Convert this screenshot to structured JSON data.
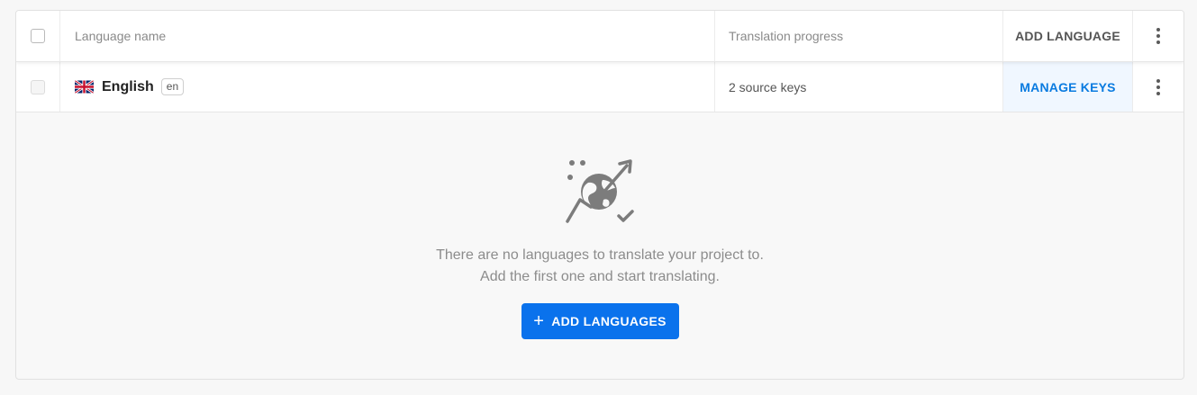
{
  "header": {
    "columns": {
      "language_name": "Language name",
      "translation_progress": "Translation progress"
    },
    "add_language_label": "ADD LANGUAGE",
    "menu_icon": "kebab-menu-icon"
  },
  "languages": [
    {
      "flag_icon": "uk-flag-icon",
      "name": "English",
      "code": "en",
      "progress": "2 source keys",
      "action_label": "MANAGE KEYS"
    }
  ],
  "empty_state": {
    "icon": "globe-translate-icon",
    "line1": "There are no languages to translate your project to.",
    "line2": "Add the first one and start translating.",
    "button_label": "ADD LANGUAGES",
    "button_icon": "plus-icon"
  },
  "colors": {
    "accent": "#0a72ec",
    "link": "#0a7be0"
  }
}
